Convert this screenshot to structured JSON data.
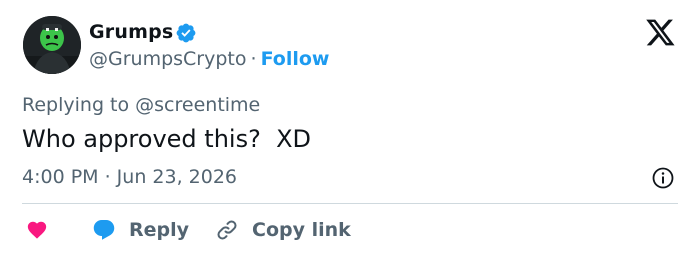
{
  "author": {
    "name": "Grumps",
    "handle": "@GrumpsCrypto",
    "separator": "·",
    "follow_label": "Follow",
    "verified": true
  },
  "reply_context": {
    "text": "Replying to @screentime"
  },
  "tweet": {
    "text": "Who approved this?  XD",
    "timestamp": "4:00 PM · Jun 23, 2026"
  },
  "actions": {
    "reply_label": "Reply",
    "copy_link_label": "Copy link"
  },
  "icons": {
    "brand": "x-logo-icon",
    "verified": "verified-badge-icon",
    "info": "info-icon",
    "like": "heart-icon",
    "reply": "reply-bubble-icon",
    "copy_link": "link-icon"
  },
  "colors": {
    "accent": "#1d9bf0",
    "heart": "#f91880",
    "secondary_text": "#536471",
    "primary_text": "#0f1419",
    "divider": "#cfd9de"
  }
}
